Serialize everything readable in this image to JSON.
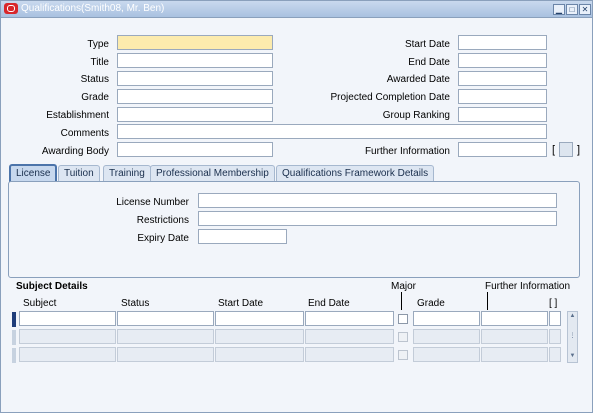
{
  "window": {
    "title": "Qualifications(Smith08, Mr. Ben)",
    "minimize": "▁",
    "maximize": "□",
    "close": "✕"
  },
  "colors": {
    "required_field": "#fcebad",
    "accent": "#4c74aa",
    "title_bar": "#a9c1e0"
  },
  "form": {
    "left_labels": {
      "type": "Type",
      "title": "Title",
      "status": "Status",
      "grade": "Grade",
      "establishment": "Establishment",
      "comments": "Comments",
      "awarding_body": "Awarding Body"
    },
    "right_labels": {
      "start_date": "Start Date",
      "end_date": "End Date",
      "awarded_date": "Awarded Date",
      "projected_completion_date": "Projected Completion Date",
      "group_ranking": "Group Ranking",
      "further_information": "Further Information"
    },
    "flex_open": "[",
    "flex_close": "]"
  },
  "tabs": [
    "License",
    "Tuition",
    "Training",
    "Professional Membership",
    "Qualifications Framework Details"
  ],
  "license": {
    "license_number": "License Number",
    "restrictions": "Restrictions",
    "expiry_date": "Expiry Date"
  },
  "subject_details": {
    "heading": "Subject Details",
    "columns": {
      "subject": "Subject",
      "status": "Status",
      "start_date": "Start Date",
      "end_date": "End Date",
      "major": "Major",
      "grade": "Grade",
      "further_information": "Further Information",
      "flex": "[ ]"
    }
  }
}
